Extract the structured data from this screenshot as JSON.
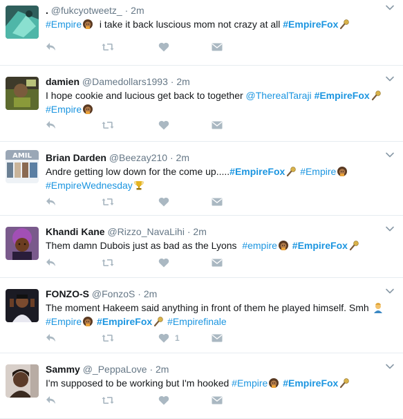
{
  "colors": {
    "link": "#1b95e0",
    "muted": "#657786",
    "icon": "#aab8c2",
    "divider": "#e6ecf0"
  },
  "tweets": [
    {
      "name": ".",
      "handle": "@fukcyotweetz_",
      "sep": "·",
      "time": "2m",
      "like_count": "",
      "avatar": "avatar-teal-photo",
      "segments": [
        {
          "type": "hashtag",
          "text": "#Empire"
        },
        {
          "type": "emoji",
          "name": "empire-emoji"
        },
        {
          "type": "text",
          "text": "  i take it back luscious mom not crazy at all "
        },
        {
          "type": "hashtag_bold",
          "text": "#EmpireFox"
        },
        {
          "type": "emoji",
          "name": "microphone-emoji"
        }
      ]
    },
    {
      "name": "damien",
      "handle": "@Damedollars1993",
      "sep": "·",
      "time": "2m",
      "like_count": "",
      "avatar": "avatar-dark-photo",
      "segments": [
        {
          "type": "text",
          "text": "I hope cookie and lucious get back to together "
        },
        {
          "type": "mention",
          "text": "@TherealTaraji"
        },
        {
          "type": "text",
          "text": " "
        },
        {
          "type": "hashtag_bold",
          "text": "#EmpireFox"
        },
        {
          "type": "emoji",
          "name": "microphone-emoji"
        },
        {
          "type": "text",
          "text": " "
        },
        {
          "type": "hashtag",
          "text": "#Empire"
        },
        {
          "type": "emoji",
          "name": "empire-emoji"
        }
      ]
    },
    {
      "name": "Brian Darden",
      "handle": "@Beezay210",
      "sep": "·",
      "time": "2m",
      "like_count": "",
      "avatar": "avatar-family-banner",
      "avatar_text": "AMIL",
      "segments": [
        {
          "type": "text",
          "text": "Andre getting low down for the come up....."
        },
        {
          "type": "hashtag_bold",
          "text": "#EmpireFox"
        },
        {
          "type": "emoji",
          "name": "microphone-emoji"
        },
        {
          "type": "text",
          "text": " "
        },
        {
          "type": "hashtag",
          "text": "#Empire"
        },
        {
          "type": "emoji",
          "name": "empire-emoji"
        },
        {
          "type": "text",
          "text": " "
        },
        {
          "type": "hashtag",
          "text": "#EmpireWednesday"
        },
        {
          "type": "emoji",
          "name": "trophy-emoji"
        }
      ]
    },
    {
      "name": "Khandi Kane",
      "handle": "@Rizzo_NavaLihi",
      "sep": "·",
      "time": "2m",
      "like_count": "",
      "avatar": "avatar-illustration",
      "segments": [
        {
          "type": "text",
          "text": "Them damn Dubois just as bad as the Lyons  "
        },
        {
          "type": "hashtag",
          "text": "#empire"
        },
        {
          "type": "emoji",
          "name": "empire-emoji"
        },
        {
          "type": "text",
          "text": " "
        },
        {
          "type": "hashtag_bold",
          "text": "#EmpireFox"
        },
        {
          "type": "emoji",
          "name": "microphone-emoji"
        }
      ]
    },
    {
      "name": "FONZO-S",
      "handle": "@FonzoS",
      "sep": "·",
      "time": "2m",
      "like_count": "1",
      "avatar": "avatar-person-photo",
      "segments": [
        {
          "type": "text",
          "text": "The moment Hakeem said anything in front of them he played himself. Smh "
        },
        {
          "type": "emoji",
          "name": "facepalm-emoji"
        },
        {
          "type": "text",
          "text": " "
        },
        {
          "type": "hashtag",
          "text": "#Empire"
        },
        {
          "type": "emoji",
          "name": "empire-emoji"
        },
        {
          "type": "text",
          "text": " "
        },
        {
          "type": "hashtag_bold",
          "text": "#EmpireFox"
        },
        {
          "type": "emoji",
          "name": "microphone-emoji"
        },
        {
          "type": "text",
          "text": " "
        },
        {
          "type": "hashtag",
          "text": "#Empirefinale"
        }
      ]
    },
    {
      "name": "Sammy",
      "handle": "@_PeppaLove",
      "sep": "·",
      "time": "2m",
      "like_count": "",
      "avatar": "avatar-selfie-photo",
      "segments": [
        {
          "type": "text",
          "text": "I'm supposed to be working but I'm hooked "
        },
        {
          "type": "hashtag",
          "text": "#Empire"
        },
        {
          "type": "emoji",
          "name": "empire-emoji"
        },
        {
          "type": "text",
          "text": " "
        },
        {
          "type": "hashtag_bold",
          "text": "#EmpireFox"
        },
        {
          "type": "emoji",
          "name": "microphone-emoji"
        }
      ]
    }
  ]
}
